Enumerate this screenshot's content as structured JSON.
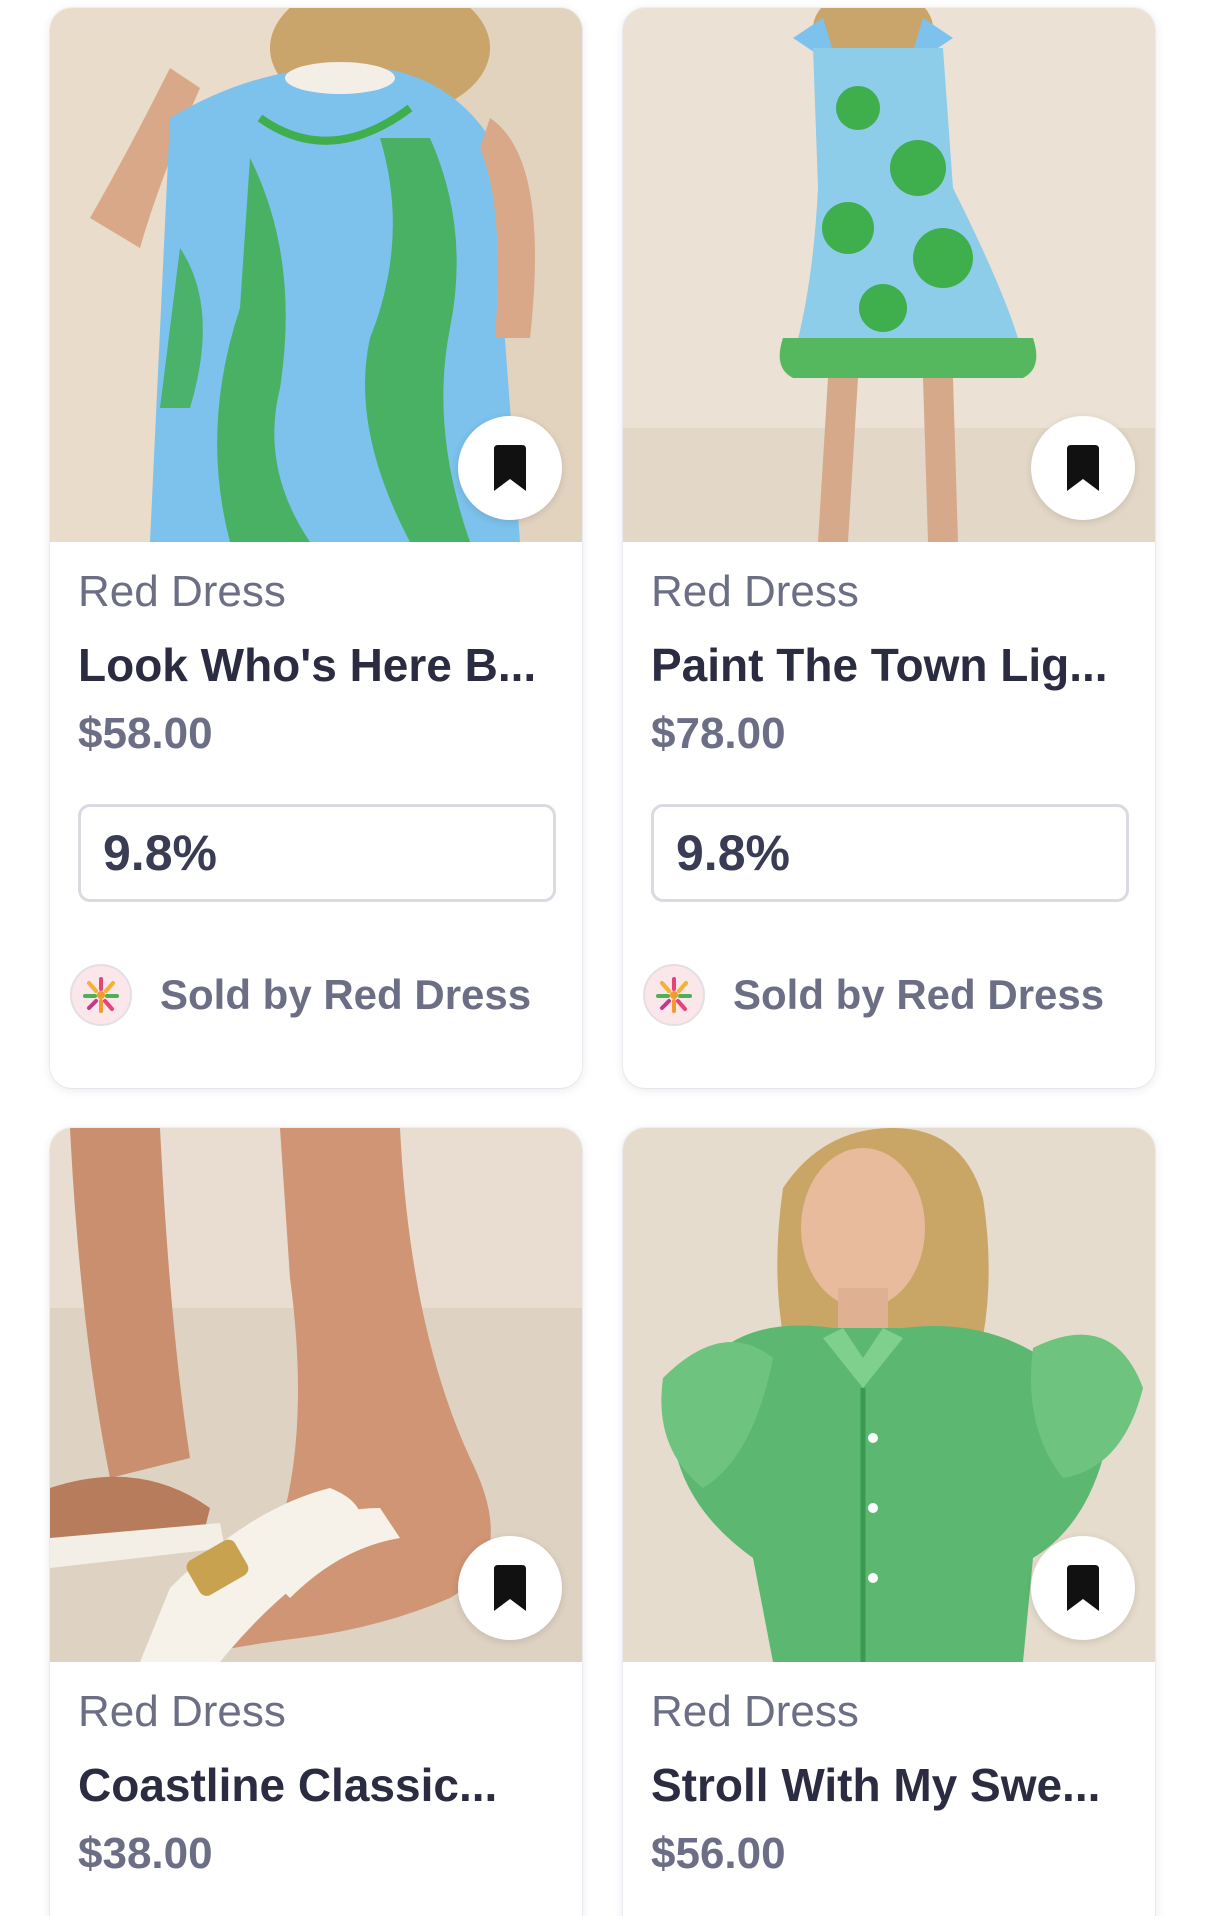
{
  "colors": {
    "brand_text": "#6c6e85",
    "title_text": "#2b2c41",
    "rate_text": "#3a3b54",
    "card_border": "#d9dae2"
  },
  "products": [
    {
      "brand": "Red Dress",
      "title": "Look Who's Here B...",
      "price": "$58.00",
      "rate": "9.8%",
      "seller": "Sold by Red Dress",
      "image": "blue-green-floral-dress-photo",
      "save_icon": "bookmark-icon"
    },
    {
      "brand": "Red Dress",
      "title": "Paint The Town Lig...",
      "price": "$78.00",
      "rate": "9.8%",
      "seller": "Sold by Red Dress",
      "image": "green-floral-mini-dress-photo",
      "save_icon": "bookmark-icon"
    },
    {
      "brand": "Red Dress",
      "title": "Coastline Classic...",
      "price": "$38.00",
      "image": "white-sandal-photo",
      "save_icon": "bookmark-icon"
    },
    {
      "brand": "Red Dress",
      "title": "Stroll With My Swe...",
      "price": "$56.00",
      "image": "green-gingham-top-photo",
      "save_icon": "bookmark-icon"
    }
  ]
}
